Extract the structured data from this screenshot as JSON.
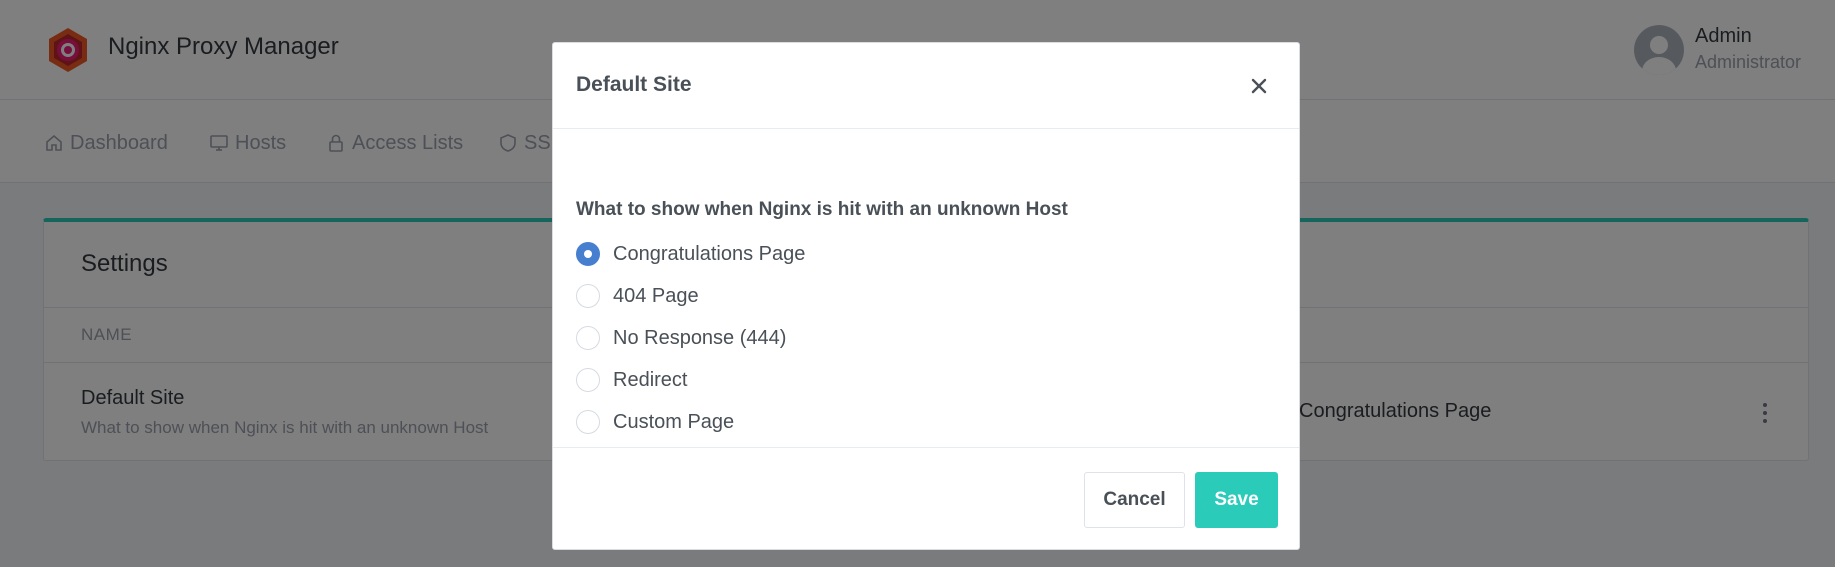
{
  "header": {
    "app_title": "Nginx Proxy Manager",
    "user_name": "Admin",
    "user_role": "Administrator"
  },
  "nav": {
    "items": [
      {
        "label": "Dashboard",
        "icon": "home-icon"
      },
      {
        "label": "Hosts",
        "icon": "monitor-icon"
      },
      {
        "label": "Access Lists",
        "icon": "lock-icon"
      },
      {
        "label": "SSL",
        "icon": "shield-icon"
      }
    ]
  },
  "settings_card": {
    "title": "Settings",
    "column_name": "NAME",
    "row": {
      "name": "Default Site",
      "description": "What to show when Nginx is hit with an unknown Host",
      "value": "Congratulations Page"
    }
  },
  "modal": {
    "title": "Default Site",
    "question": "What to show when Nginx is hit with an unknown Host",
    "options": [
      {
        "label": "Congratulations Page",
        "checked": true
      },
      {
        "label": "404 Page",
        "checked": false
      },
      {
        "label": "No Response (444)",
        "checked": false
      },
      {
        "label": "Redirect",
        "checked": false
      },
      {
        "label": "Custom Page",
        "checked": false
      }
    ],
    "cancel_label": "Cancel",
    "save_label": "Save"
  },
  "colors": {
    "accent": "#2bcbba",
    "radio_checked": "#467fcf",
    "overlay": "rgba(0,0,0,0.5)"
  }
}
